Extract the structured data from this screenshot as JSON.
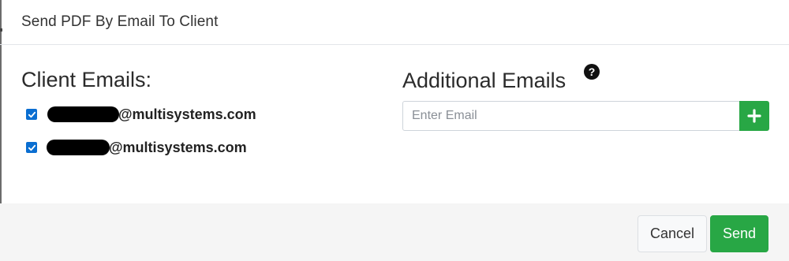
{
  "dialog": {
    "title": "Send PDF By Email To Client"
  },
  "client_emails": {
    "heading": "Client Emails:",
    "items": [
      {
        "checked": true,
        "domain": "@multisystems.com"
      },
      {
        "checked": true,
        "domain": "@multisystems.com"
      }
    ]
  },
  "additional_emails": {
    "heading": "Additional Emails",
    "help_icon": "question-circle-icon",
    "input_placeholder": "Enter Email",
    "input_value": "",
    "add_icon": "plus-icon"
  },
  "footer": {
    "cancel_label": "Cancel",
    "send_label": "Send"
  },
  "colors": {
    "primary_green": "#28a745",
    "checkbox_blue": "#0a6ed1",
    "footer_bg": "#f5f5f5"
  }
}
